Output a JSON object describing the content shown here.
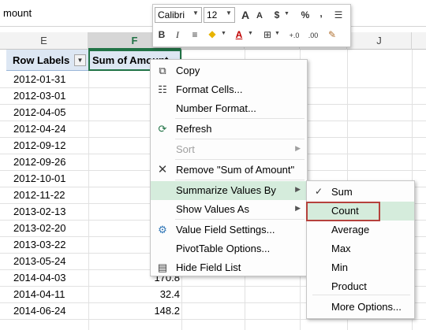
{
  "formula_bar": {
    "text": "mount"
  },
  "columns": {
    "e": "E",
    "f": "F",
    "j": "J"
  },
  "pivot": {
    "row_labels_header": "Row Labels",
    "sum_header": "Sum of Amount",
    "rows": [
      {
        "label": "2012-01-31",
        "value": ""
      },
      {
        "label": "2012-03-01",
        "value": ""
      },
      {
        "label": "2012-04-05",
        "value": ""
      },
      {
        "label": "2012-04-24",
        "value": ""
      },
      {
        "label": "2012-09-12",
        "value": ""
      },
      {
        "label": "2012-09-26",
        "value": ""
      },
      {
        "label": "2012-10-01",
        "value": ""
      },
      {
        "label": "2012-11-22",
        "value": ""
      },
      {
        "label": "2013-02-13",
        "value": ""
      },
      {
        "label": "2013-02-20",
        "value": ""
      },
      {
        "label": "2013-03-22",
        "value": ""
      },
      {
        "label": "2013-05-24",
        "value": ""
      },
      {
        "label": "2014-04-03",
        "value": "170.8"
      },
      {
        "label": "2014-04-11",
        "value": "32.4"
      },
      {
        "label": "2014-06-24",
        "value": "148.2"
      }
    ]
  },
  "mini_toolbar": {
    "font_name": "Calibri",
    "font_size": "12",
    "increase_font_icon": "A",
    "decrease_font_icon": "A",
    "currency_icon": "$",
    "percent_icon": "%",
    "comma_icon": ",",
    "bold_icon": "B",
    "italic_icon": "I",
    "font_color_icon": "A",
    "decimal_increase_icon": "+.0",
    "decimal_decrease_icon": ".00"
  },
  "context_menu": {
    "copy": "Copy",
    "format_cells": "Format Cells...",
    "number_format": "Number Format...",
    "refresh": "Refresh",
    "sort": "Sort",
    "remove": "Remove \"Sum of Amount\"",
    "summarize": "Summarize Values By",
    "show_values_as": "Show Values As",
    "value_field_settings": "Value Field Settings...",
    "pivottable_options": "PivotTable Options...",
    "hide_field_list": "Hide Field List"
  },
  "submenu": {
    "sum": "Sum",
    "count": "Count",
    "average": "Average",
    "max": "Max",
    "min": "Min",
    "product": "Product",
    "more_options": "More Options..."
  },
  "colors": {
    "excel_green": "#217346",
    "highlight": "#d5ecdc",
    "annotation_red": "#b5413c"
  }
}
